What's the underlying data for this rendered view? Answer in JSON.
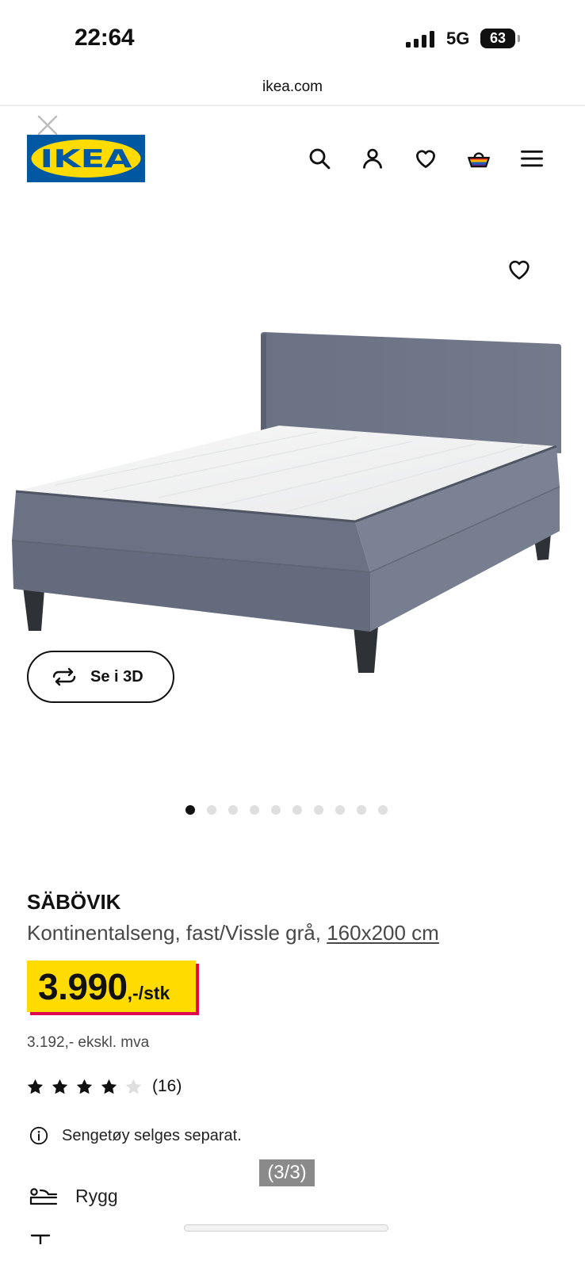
{
  "status_bar": {
    "time": "22:64",
    "network": "5G",
    "battery": "63"
  },
  "browser": {
    "url": "ikea.com"
  },
  "header": {
    "logo_text": "IKEA",
    "icons": {
      "close": "close-icon",
      "search": "search-icon",
      "account": "user-icon",
      "favourites": "heart-icon",
      "cart": "shopping-basket-icon",
      "menu": "hamburger-menu-icon"
    }
  },
  "gallery": {
    "favourite_icon": "heart-icon",
    "view_3d_icon": "rotate-360-icon",
    "view_3d_label": "Se i 3D",
    "image_count": 10,
    "active_image": 1
  },
  "product": {
    "name": "SÄBÖVIK",
    "description": "Kontinentalseng, fast/Vissle grå, ",
    "size_link": "160x200 cm",
    "price": "3.990",
    "price_suffix": ",-/stk",
    "price_excl_vat": "3.192,- ekskl. mva",
    "rating": 4,
    "rating_max": 5,
    "review_count": "(16)",
    "notice_icon": "info-icon",
    "notice": "Sengetøy selges separat.",
    "feature_icon": "backrest-icon",
    "feature_label": "Rygg"
  },
  "overlay": {
    "frame_counter": "(3/3)"
  },
  "colors": {
    "brand_blue": "#0058a3",
    "brand_yellow": "#ffdb00",
    "price_shadow": "#e00751",
    "text_primary": "#111111",
    "text_secondary": "#484848",
    "dot_active": "#111111",
    "dot_inactive": "#dfdfdf",
    "star_filled": "#111111",
    "star_empty": "#dfdfdf"
  }
}
